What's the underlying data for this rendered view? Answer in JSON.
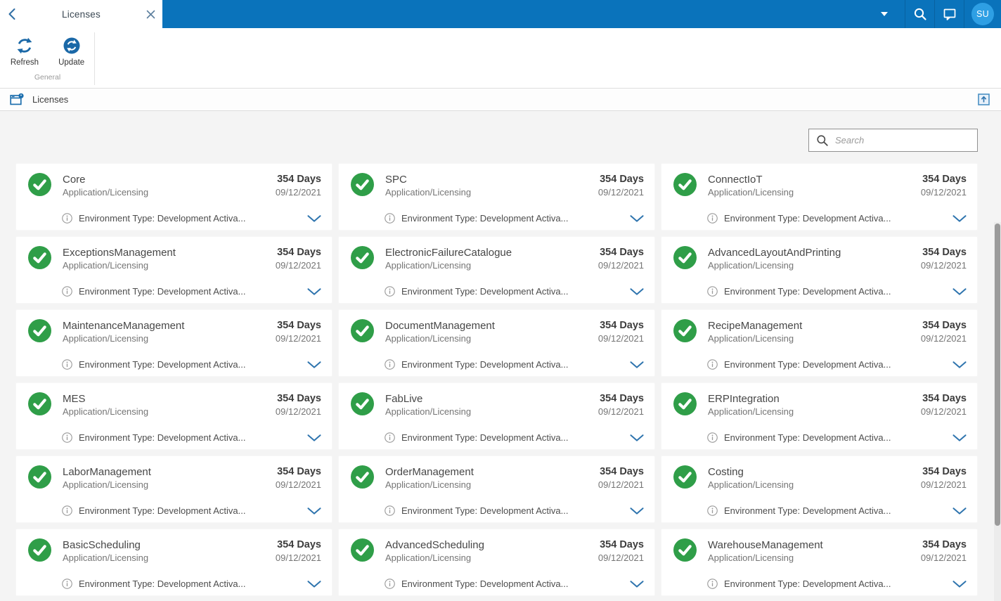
{
  "topbar": {
    "tab_title": "Licenses",
    "avatar_initials": "SU"
  },
  "toolbar": {
    "refresh_label": "Refresh",
    "update_label": "Update",
    "group_label": "General"
  },
  "page_header": {
    "title": "Licenses"
  },
  "search": {
    "placeholder": "Search",
    "value": ""
  },
  "colors": {
    "topbar_blue": "#0a73bb",
    "avatar_blue": "#2e9fe4",
    "icon_blue": "#1a68a7",
    "status_green": "#2f9e48",
    "chevron_blue": "#2e74ae"
  },
  "icons": {
    "back": "chevron-left-icon",
    "close_tab": "close-icon",
    "menu": "caret-down-icon",
    "search": "search-icon",
    "chat": "chat-icon",
    "refresh": "refresh-icon",
    "update": "update-sync-icon",
    "page": "window-badge-icon",
    "collapse": "collapse-panel-icon",
    "status": "check-circle-icon",
    "info": "info-icon",
    "expand_card": "chevron-down-icon"
  },
  "licenses": {
    "items": [
      {
        "name": "Core",
        "category": "Application/Licensing",
        "days": "354 Days",
        "date": "09/12/2021",
        "detail": "Environment Type: Development Activa..."
      },
      {
        "name": "SPC",
        "category": "Application/Licensing",
        "days": "354 Days",
        "date": "09/12/2021",
        "detail": "Environment Type: Development Activa..."
      },
      {
        "name": "ConnectIoT",
        "category": "Application/Licensing",
        "days": "354 Days",
        "date": "09/12/2021",
        "detail": "Environment Type: Development Activa..."
      },
      {
        "name": "ExceptionsManagement",
        "category": "Application/Licensing",
        "days": "354 Days",
        "date": "09/12/2021",
        "detail": "Environment Type: Development Activa..."
      },
      {
        "name": "ElectronicFailureCatalogue",
        "category": "Application/Licensing",
        "days": "354 Days",
        "date": "09/12/2021",
        "detail": "Environment Type: Development Activa..."
      },
      {
        "name": "AdvancedLayoutAndPrinting",
        "category": "Application/Licensing",
        "days": "354 Days",
        "date": "09/12/2021",
        "detail": "Environment Type: Development Activa..."
      },
      {
        "name": "MaintenanceManagement",
        "category": "Application/Licensing",
        "days": "354 Days",
        "date": "09/12/2021",
        "detail": "Environment Type: Development Activa..."
      },
      {
        "name": "DocumentManagement",
        "category": "Application/Licensing",
        "days": "354 Days",
        "date": "09/12/2021",
        "detail": "Environment Type: Development Activa..."
      },
      {
        "name": "RecipeManagement",
        "category": "Application/Licensing",
        "days": "354 Days",
        "date": "09/12/2021",
        "detail": "Environment Type: Development Activa..."
      },
      {
        "name": "MES",
        "category": "Application/Licensing",
        "days": "354 Days",
        "date": "09/12/2021",
        "detail": "Environment Type: Development Activa..."
      },
      {
        "name": "FabLive",
        "category": "Application/Licensing",
        "days": "354 Days",
        "date": "09/12/2021",
        "detail": "Environment Type: Development Activa..."
      },
      {
        "name": "ERPIntegration",
        "category": "Application/Licensing",
        "days": "354 Days",
        "date": "09/12/2021",
        "detail": "Environment Type: Development Activa..."
      },
      {
        "name": "LaborManagement",
        "category": "Application/Licensing",
        "days": "354 Days",
        "date": "09/12/2021",
        "detail": "Environment Type: Development Activa..."
      },
      {
        "name": "OrderManagement",
        "category": "Application/Licensing",
        "days": "354 Days",
        "date": "09/12/2021",
        "detail": "Environment Type: Development Activa..."
      },
      {
        "name": "Costing",
        "category": "Application/Licensing",
        "days": "354 Days",
        "date": "09/12/2021",
        "detail": "Environment Type: Development Activa..."
      },
      {
        "name": "BasicScheduling",
        "category": "Application/Licensing",
        "days": "354 Days",
        "date": "09/12/2021",
        "detail": "Environment Type: Development Activa..."
      },
      {
        "name": "AdvancedScheduling",
        "category": "Application/Licensing",
        "days": "354 Days",
        "date": "09/12/2021",
        "detail": "Environment Type: Development Activa..."
      },
      {
        "name": "WarehouseManagement",
        "category": "Application/Licensing",
        "days": "354 Days",
        "date": "09/12/2021",
        "detail": "Environment Type: Development Activa..."
      }
    ]
  }
}
